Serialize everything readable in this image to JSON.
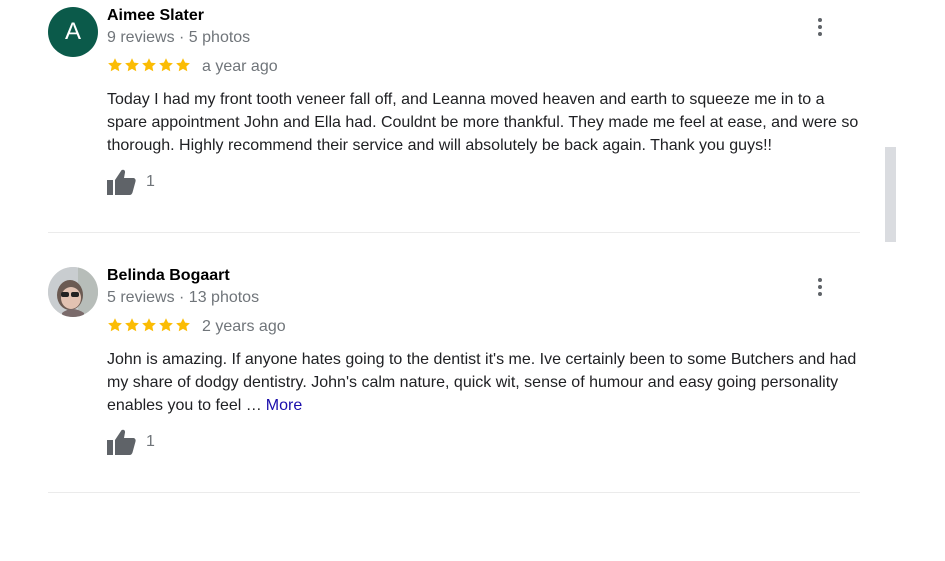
{
  "reviews": [
    {
      "avatar_letter": "A",
      "name": "Aimee Slater",
      "meta": "9 reviews · 5 photos",
      "rating": 5,
      "when": "a year ago",
      "text": "Today I had my front tooth veneer fall off, and Leanna moved heaven and earth to squeeze me in to a spare appointment John and Ella had.  Couldnt be more thankful. They made me feel at ease, and were so thorough. Highly recommend their service and will absolutely be back again. Thank you guys!!",
      "likes": "1"
    },
    {
      "avatar_letter": "",
      "name": "Belinda Bogaart",
      "meta": "5 reviews · 13 photos",
      "rating": 5,
      "when": "2 years ago",
      "text": "John is amazing. If anyone hates going to the dentist it's me. Ive certainly been to some Butchers and had my share of dodgy dentistry.  John's calm nature, quick wit, sense of humour and easy going personality enables you to feel …",
      "more_label": "More",
      "likes": "1"
    }
  ],
  "colors": {
    "star": "#fbbc04",
    "avatar_bg": "#0b5a4a",
    "link": "#1a0dab",
    "meta_text": "#70757a"
  },
  "icons": {
    "star": "star-icon",
    "thumb": "thumbs-up-icon",
    "menu": "more-vert-icon"
  }
}
